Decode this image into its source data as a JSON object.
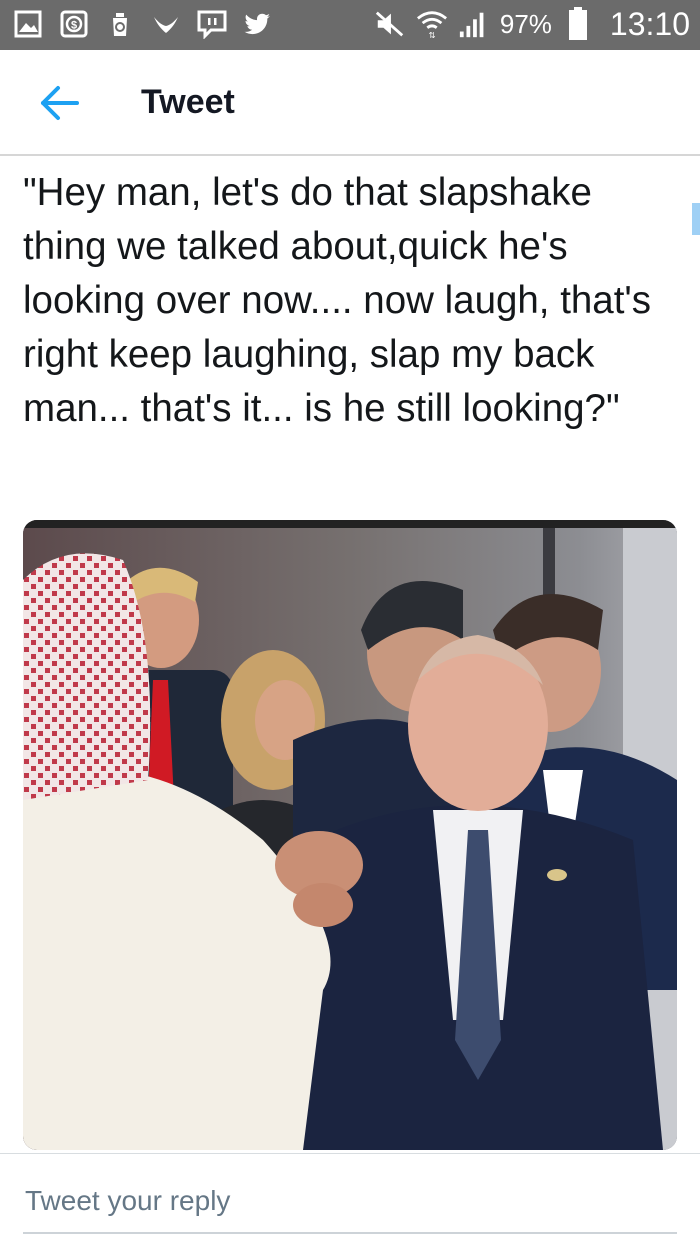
{
  "status_bar": {
    "notification_icons": [
      "gallery-icon",
      "shop-icon",
      "recycle-icon",
      "bird-icon",
      "chat-icon",
      "twitter-icon"
    ],
    "system_icons": [
      "mute-icon",
      "wifi-icon",
      "signal-icon",
      "battery-icon"
    ],
    "battery_percent": "97%",
    "battery_level": 0.97,
    "time": "13:10"
  },
  "app_bar": {
    "title": "Tweet",
    "back_icon": "back-arrow-icon",
    "accent_color": "#1da1f2"
  },
  "tweet": {
    "text": "\"Hey man, let's do that slapshake thing we talked about,quick he's looking over now.... now laugh, that's right keep laughing, slap my back man... that's it... is he still looking?\"",
    "media": {
      "kind": "photo",
      "description_name": "tweet-photo"
    }
  },
  "reply": {
    "placeholder": "Tweet your reply"
  }
}
